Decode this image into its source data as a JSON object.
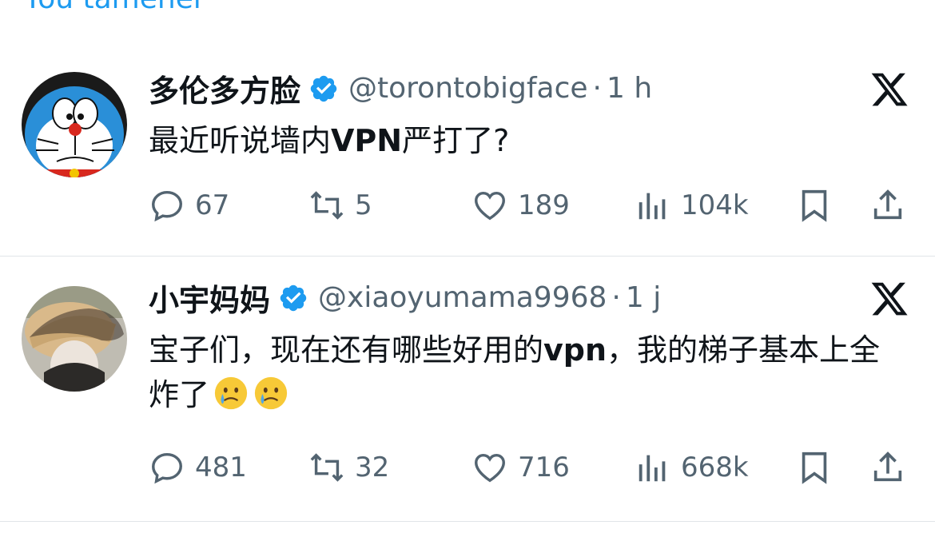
{
  "top_fragment": "You tamener",
  "tweets": [
    {
      "name": "多伦多方脸",
      "handle": "@torontobigface",
      "separator": "·",
      "time": "1 h",
      "text_before": "最近听说墙内",
      "text_bold": "VPN",
      "text_after": "严打了?",
      "replies": "67",
      "reposts": "5",
      "likes": "189",
      "views": "104k"
    },
    {
      "name": "小宇妈妈",
      "handle": "@xiaoyumama9968",
      "separator": "·",
      "time": "1 j",
      "text_before": "宝子们，现在还有哪些好用的",
      "text_bold": "vpn",
      "text_after": "，我的梯子基本上全炸了",
      "replies": "481",
      "reposts": "32",
      "likes": "716",
      "views": "668k"
    }
  ],
  "colors": {
    "verified": "#1d9bf0",
    "text": "#0f1419",
    "secondary": "#536471",
    "divider": "#e1e5e8"
  },
  "icons": [
    "reply-icon",
    "repost-icon",
    "like-icon",
    "views-icon",
    "bookmark-icon",
    "share-icon",
    "x-logo-icon",
    "verified-badge-icon",
    "crying-face-emoji"
  ]
}
